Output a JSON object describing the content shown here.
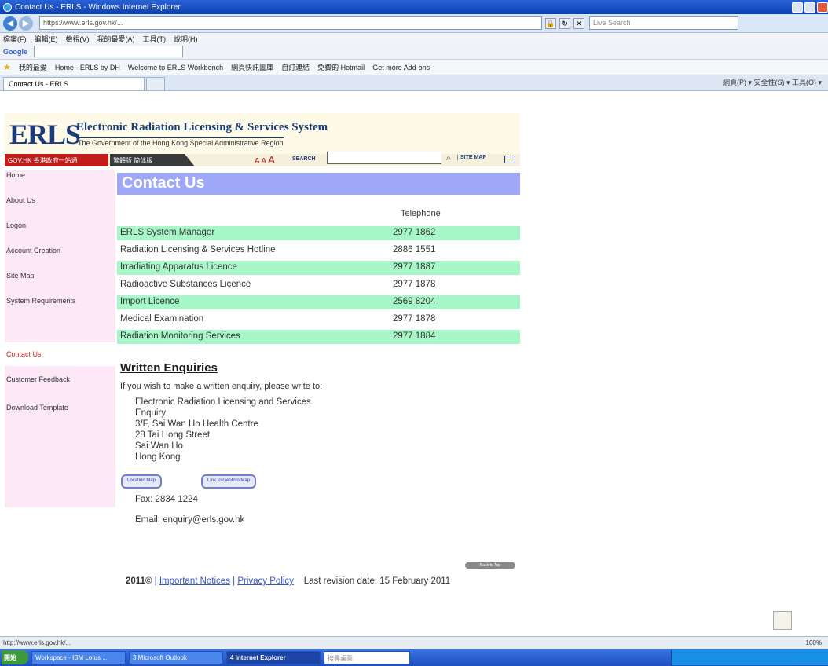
{
  "window": {
    "title": "Contact Us - ERLS - Windows Internet Explorer"
  },
  "browser": {
    "address": "https://www.erls.gov.hk/...",
    "live_search_placeholder": "Live Search",
    "menu": [
      "檔案(F)",
      "編輯(E)",
      "檢視(V)",
      "我的最愛(A)",
      "工具(T)",
      "說明(H)"
    ],
    "google_label": "Google",
    "favorites": [
      "我的最愛",
      "Home - ERLS by DH",
      "Welcome to ERLS Workbench",
      "網頁快訊圖庫",
      "自訂連結",
      "免費的 Hotmail",
      "Get more Add-ons"
    ],
    "tab_label": "Contact Us - ERLS",
    "tab_tools": "網頁(P) ▾  安全性(S) ▾  工具(O) ▾"
  },
  "header": {
    "logo": "ERLS",
    "system_title": "Electronic Radiation Licensing & Services System",
    "subtitle": "The Government of the Hong Kong Special Administrative Region",
    "gov_label": "GOV.HK 香港政府一站通",
    "lang_label": "繁體版  简体版",
    "font_small": "A",
    "font_mid": "A",
    "font_big": "A",
    "search_label": "SEARCH",
    "site_map": "SITE MAP"
  },
  "nav": {
    "items": [
      "Home",
      "About Us",
      "Logon",
      "Account Creation",
      "Site Map",
      "System Requirements",
      "Contact Us",
      "Customer Feedback",
      "Download Template"
    ]
  },
  "content": {
    "title": "Contact Us",
    "tel_header": "Telephone",
    "contacts": [
      {
        "name": "ERLS System Manager",
        "tel": "2977 1862"
      },
      {
        "name": "Radiation Licensing & Services Hotline",
        "tel": "2886 1551"
      },
      {
        "name": "Irradiating Apparatus Licence",
        "tel": "2977 1887"
      },
      {
        "name": "Radioactive Substances Licence",
        "tel": "2977 1878"
      },
      {
        "name": "Import Licence",
        "tel": "2569 8204"
      },
      {
        "name": "Medical Examination",
        "tel": "2977 1878"
      },
      {
        "name": "Radiation Monitoring Services",
        "tel": "2977 1884"
      }
    ],
    "written_title": "Written Enquiries",
    "written_intro": "If you wish to make a written enquiry, please write to:",
    "address_lines": [
      "Electronic Radiation Licensing and Services",
      "Enquiry",
      "3/F, Sai Wan Ho Health Centre",
      "28 Tai Hong Street",
      "Sai Wan Ho",
      "Hong Kong"
    ],
    "location_map_btn": "Location Map",
    "link_map_btn": "Link to GeoInfo Map",
    "fax": "Fax: 2834 1224",
    "email": "Email: enquiry@erls.gov.hk"
  },
  "footer": {
    "back_to_top": "Back to Top",
    "copyright": "2011©",
    "important_notices": "Important Notices",
    "privacy_policy": "Privacy Policy",
    "revision": "Last revision date: 15 February 2011",
    "sep": "|"
  },
  "status": {
    "url": "http://www.erls.gov.hk/...",
    "zoom": "100%"
  },
  "taskbar": {
    "start": "開始",
    "tasks": [
      "Workspace - IBM Lotus ...",
      "3 Microsoft Outlook",
      "4 Internet Explorer"
    ],
    "search_placeholder": "搜尋桌面"
  }
}
